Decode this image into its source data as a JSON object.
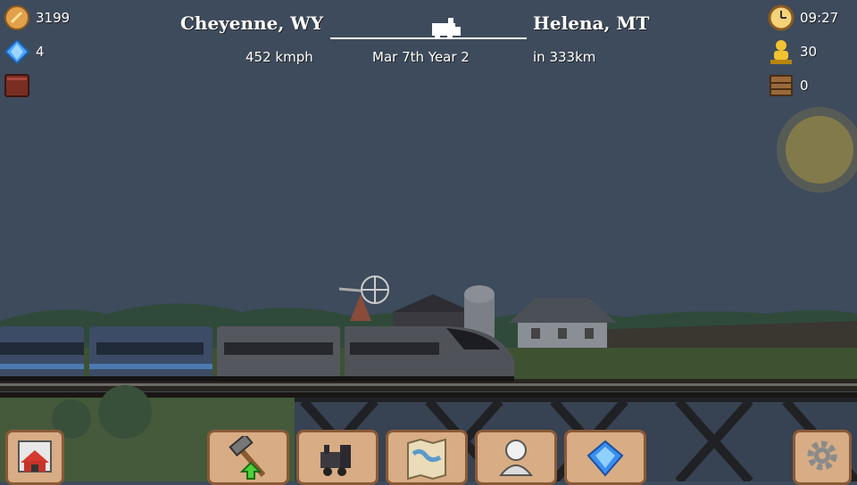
{
  "hud": {
    "coins": "3199",
    "gems": "4",
    "clock": "09:27",
    "passengers": "30",
    "cargo": "0"
  },
  "route": {
    "origin": "Cheyenne, WY",
    "destination": "Helena, MT",
    "speed": "452 kmph",
    "date": "Mar 7th  Year 2",
    "distance": "in 333km"
  },
  "toolbar": {
    "buttons": [
      "station-button",
      "upgrade-button",
      "trains-button",
      "map-button",
      "crew-button",
      "gem-shop-button",
      "settings-button"
    ]
  },
  "colors": {
    "sky": "#3d4b5c",
    "hud_button": "#d8ac84",
    "hud_button_border": "#8a5a38",
    "sun": "#9c8a4a"
  }
}
